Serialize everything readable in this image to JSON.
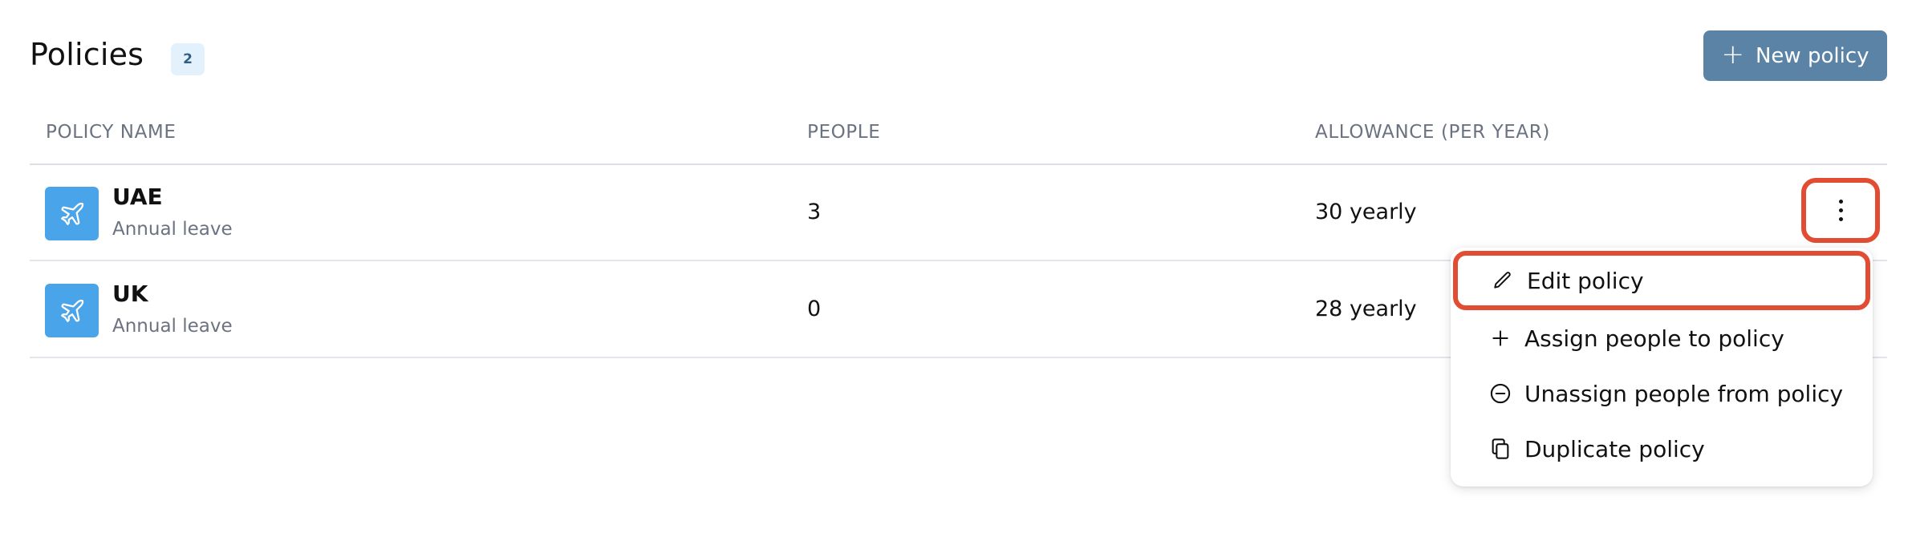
{
  "header": {
    "title": "Policies",
    "count": "2",
    "new_button_label": "New policy"
  },
  "table": {
    "columns": [
      "POLICY NAME",
      "PEOPLE",
      "ALLOWANCE (PER YEAR)"
    ],
    "rows": [
      {
        "name": "UAE",
        "type": "Annual leave",
        "people": "3",
        "allowance": "30 yearly",
        "icon": "airplane-icon"
      },
      {
        "name": "UK",
        "type": "Annual leave",
        "people": "0",
        "allowance": "28 yearly",
        "icon": "airplane-icon"
      }
    ]
  },
  "row_menu": {
    "items": [
      {
        "label": "Edit policy",
        "icon": "pencil-icon"
      },
      {
        "label": "Assign people to policy",
        "icon": "plus-icon"
      },
      {
        "label": "Unassign people from policy",
        "icon": "minus-circle-icon"
      },
      {
        "label": "Duplicate policy",
        "icon": "copy-icon"
      }
    ]
  },
  "colors": {
    "primary_button": "#5b83a6",
    "row_icon_bg": "#4aa4ea",
    "highlight": "#e24c32",
    "badge_bg": "#e3f1fc"
  }
}
